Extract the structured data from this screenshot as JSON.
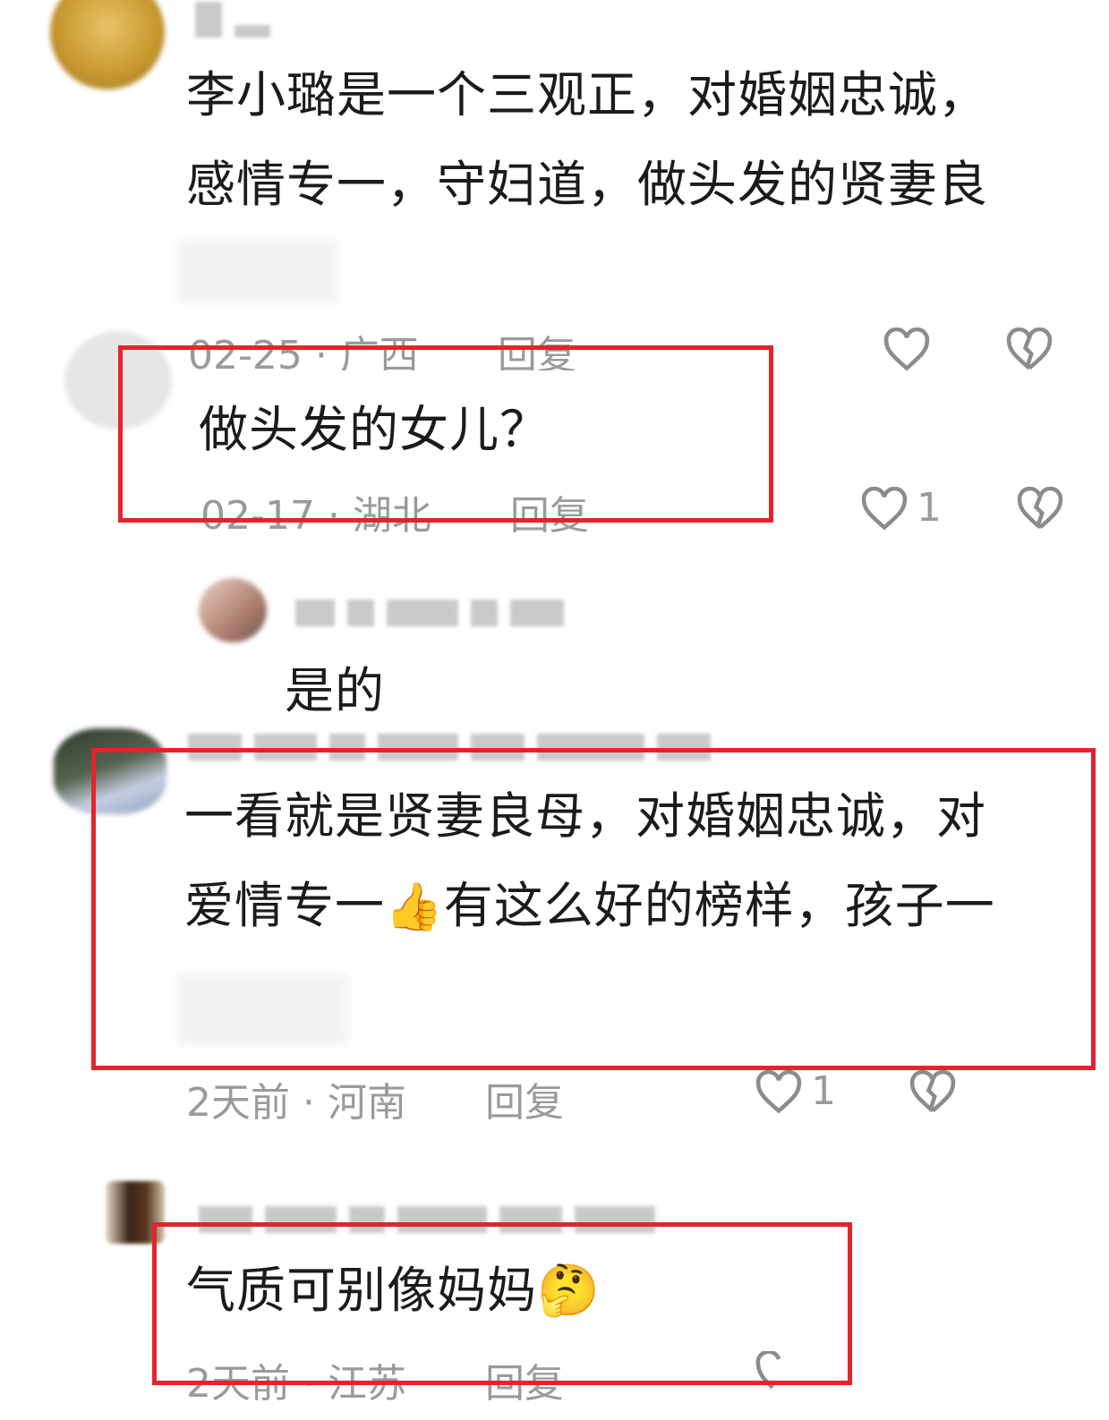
{
  "comments": [
    {
      "text_lines": [
        "李小璐是一个三观正，对婚姻忠诚，",
        "感情专一，守妇道，做头发的贤妻良"
      ],
      "meta": {
        "date": "02-25",
        "location": "广西",
        "reply": "回复"
      }
    },
    {
      "text_lines": [
        "做头发的女儿？"
      ],
      "meta": {
        "date": "02-17",
        "location": "湖北",
        "reply": "回复"
      },
      "like_count": "1"
    },
    {
      "text_lines": [
        "是的"
      ]
    },
    {
      "text_lines": [
        "一看就是贤妻良母，对婚姻忠诚，对",
        "爱情专一",
        "有这么好的榜样，孩子一"
      ],
      "emoji": "👍",
      "meta": {
        "date": "2天前",
        "location": "河南",
        "reply": "回复"
      },
      "like_count": "1"
    },
    {
      "text_lines": [
        "气质可别像妈妈"
      ],
      "emoji": "🤔",
      "meta": {
        "date": "2天前",
        "location": "江苏",
        "reply": "回复"
      }
    }
  ],
  "meta_separator": "·",
  "colors": {
    "highlight": "#e3242b",
    "meta_text": "#9a9a9a",
    "text": "#1b1b1b"
  },
  "icons": [
    "heart-icon",
    "broken-heart-icon",
    "thumbs-up-emoji",
    "thinking-emoji"
  ]
}
